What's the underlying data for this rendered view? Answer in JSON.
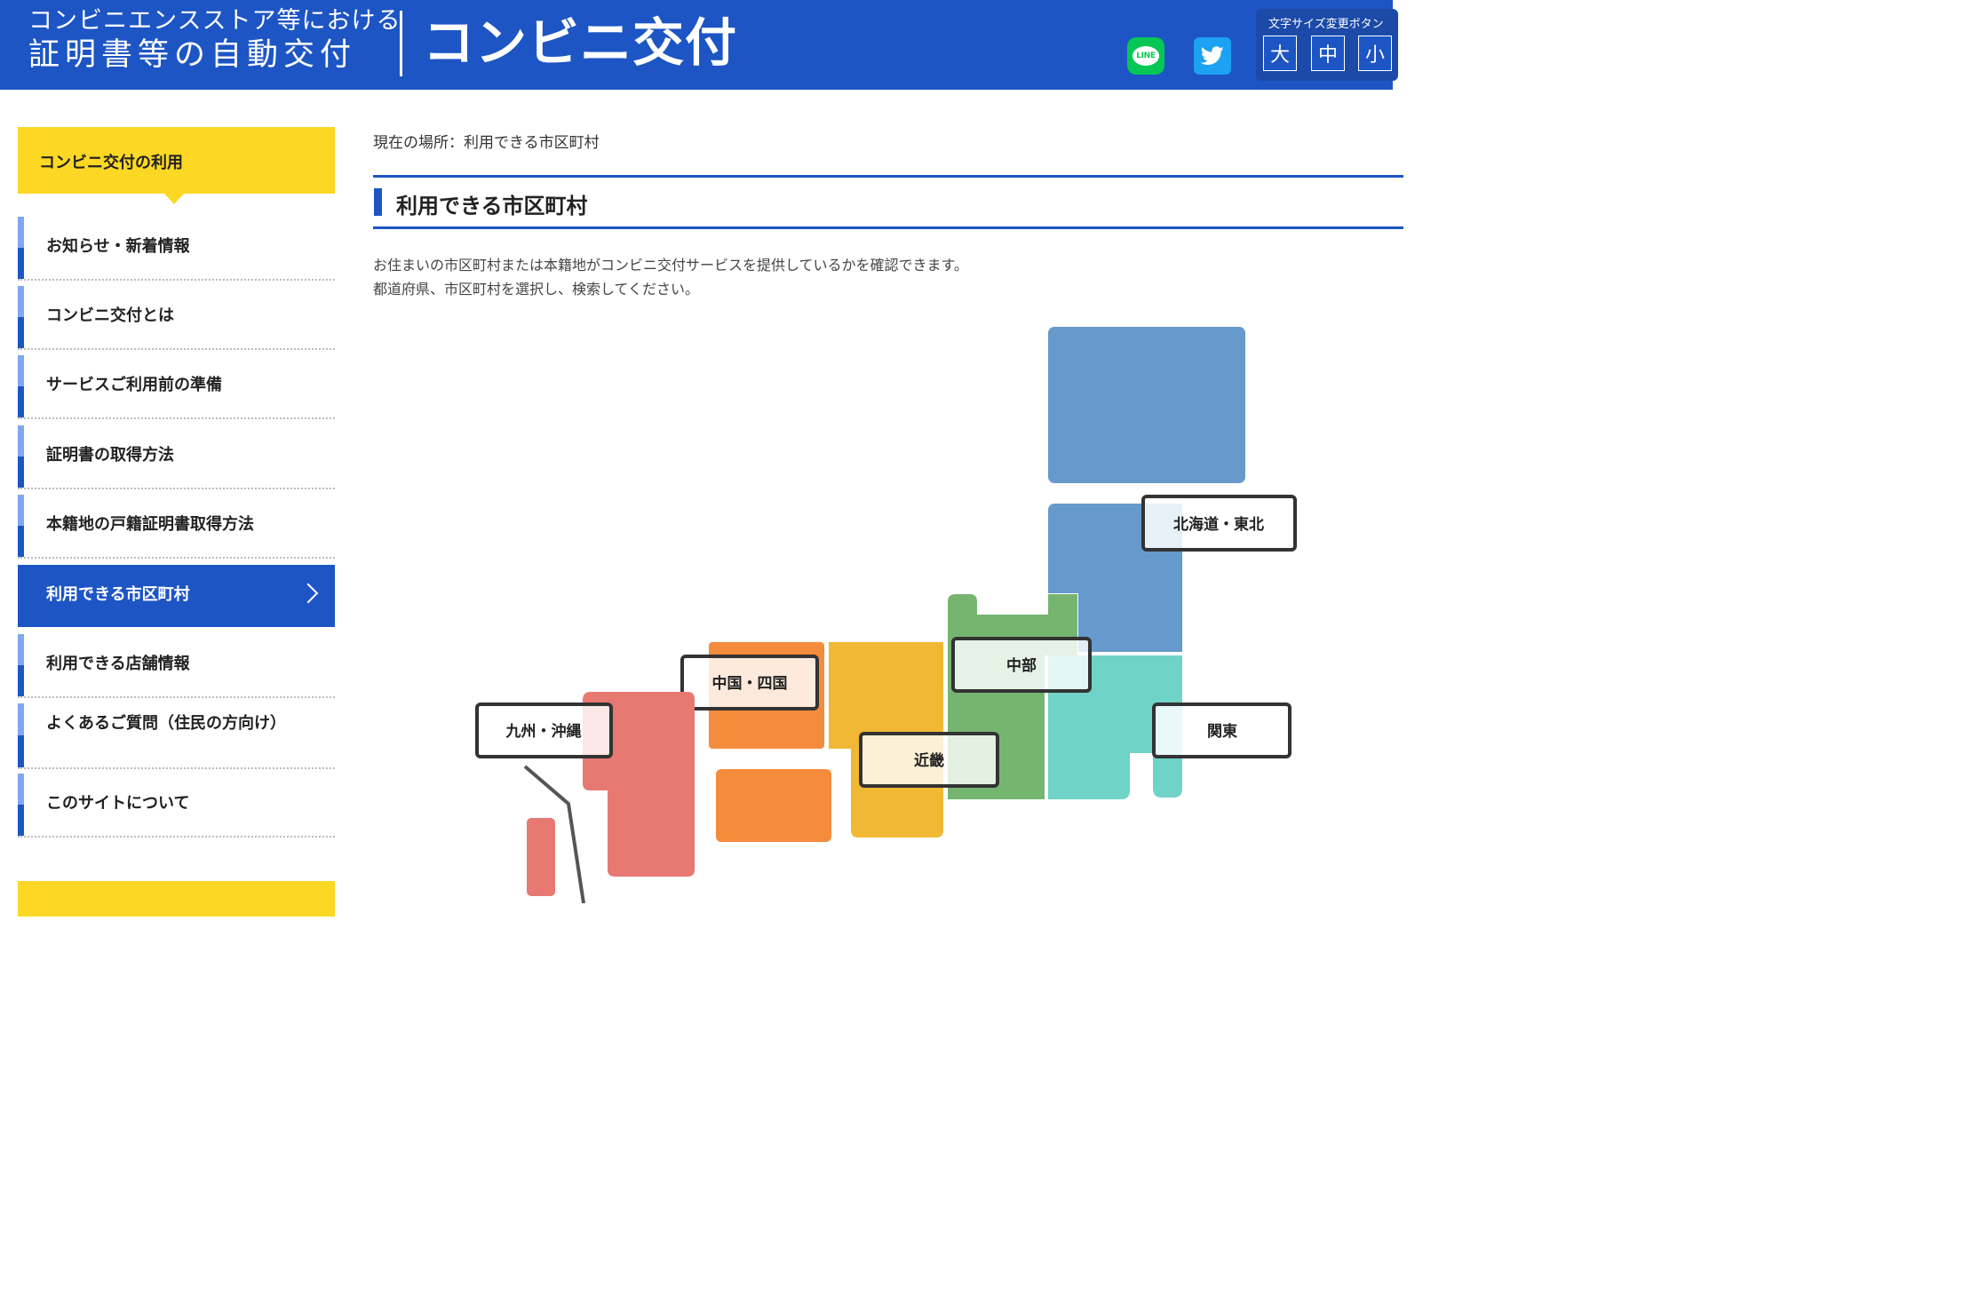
{
  "header": {
    "site_title_line1": "コンビニエンスストア等における",
    "site_title_line2": "証明書等の自動交付",
    "service_name": "コンビニ交付",
    "line_label": "LINE",
    "font_size_label": "文字サイズ変更ボタン",
    "font_size_large": "大",
    "font_size_medium": "中",
    "font_size_small": "小"
  },
  "sidebar": {
    "section_title": "コンビニ交付の利用",
    "items": [
      {
        "label": "お知らせ・新着情報"
      },
      {
        "label": "コンビニ交付とは"
      },
      {
        "label": "サービスご利用前の準備"
      },
      {
        "label": "証明書の取得方法"
      },
      {
        "label": "本籍地の戸籍証明書取得方法"
      },
      {
        "label": "利用できる市区町村",
        "active": true
      },
      {
        "label": "利用できる店舗情報"
      },
      {
        "label": "よくあるご質問（住民の方向け）"
      },
      {
        "label": "このサイトについて"
      }
    ]
  },
  "main": {
    "breadcrumb": "現在の場所：利用できる市区町村",
    "page_title": "利用できる市区町村",
    "description_line1": "お住まいの市区町村または本籍地がコンビニ交付サービスを提供しているかを確認できます。",
    "description_line2": "都道府県、市区町村を選択し、検索してください。"
  },
  "map": {
    "regions": [
      {
        "id": "hokkaido-tohoku",
        "label": "北海道・東北",
        "color": "#6699cc"
      },
      {
        "id": "kanto",
        "label": "関東",
        "color": "#6fd3c7"
      },
      {
        "id": "chubu",
        "label": "中部",
        "color": "#76b570"
      },
      {
        "id": "kinki",
        "label": "近畿",
        "color": "#f0b834"
      },
      {
        "id": "chugoku-shikoku",
        "label": "中国・四国",
        "color": "#f58c3c"
      },
      {
        "id": "kyushu-okinawa",
        "label": "九州・沖縄",
        "color": "#e87872"
      }
    ]
  },
  "colors": {
    "header_blue": "#1d55c4",
    "accent_yellow": "#fcd825",
    "line_green": "#06c755",
    "twitter_blue": "#1da1f2"
  },
  "icons": {
    "line": "line-icon",
    "twitter": "twitter-icon",
    "chevron": "chevron-right-icon"
  }
}
